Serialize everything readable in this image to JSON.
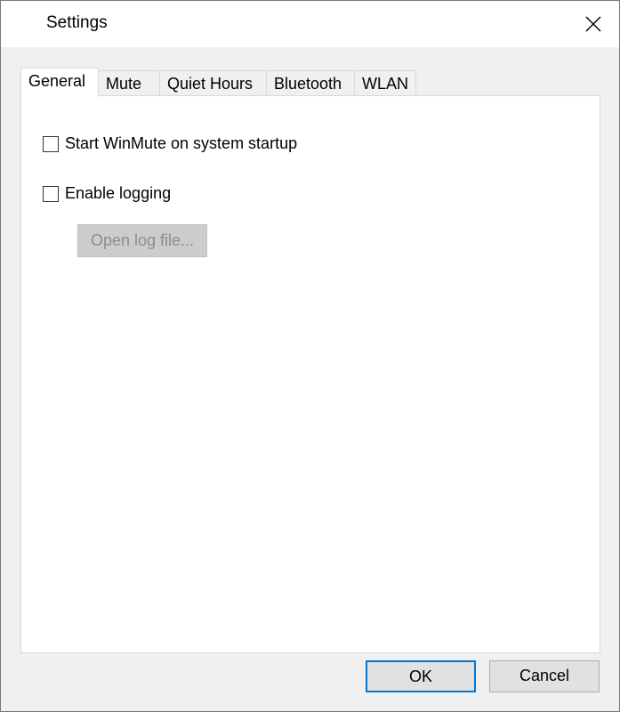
{
  "window": {
    "title": "Settings"
  },
  "tabs": [
    {
      "label": "General",
      "active": true
    },
    {
      "label": "Mute",
      "active": false
    },
    {
      "label": "Quiet Hours",
      "active": false
    },
    {
      "label": "Bluetooth",
      "active": false
    },
    {
      "label": "WLAN",
      "active": false
    }
  ],
  "general": {
    "start_on_startup": {
      "label": "Start WinMute on system startup",
      "checked": false
    },
    "enable_logging": {
      "label": "Enable logging",
      "checked": false
    },
    "open_log_button": {
      "label": "Open log file...",
      "enabled": false
    }
  },
  "footer": {
    "ok_label": "OK",
    "cancel_label": "Cancel"
  },
  "colors": {
    "accent": "#0078d7",
    "dialog_bg": "#f0f0f0",
    "panel_bg": "#ffffff",
    "disabled_text": "#8c8c8c"
  },
  "icons": {
    "close": "close-icon",
    "checkbox": "checkbox-unchecked"
  }
}
